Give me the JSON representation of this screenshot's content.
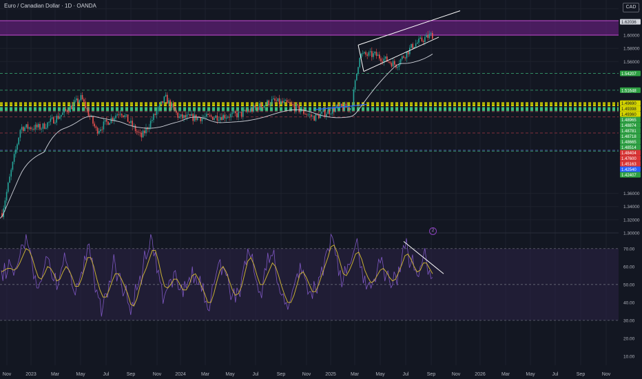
{
  "header": {
    "title": "Euro / Canadian Dollar · 1D · OANDA",
    "currency": "CAD",
    "rsi_badge": "2"
  },
  "colors": {
    "background": "#131722",
    "candle_up": "#26a69a",
    "candle_down": "#ef5350",
    "zone_fill": "#5c1f73",
    "zone_border": "#c64bd3",
    "moving_average": "#d1d4dc",
    "support_dashed": "#3fbf7f",
    "yellow_band": "#d4d400",
    "green_band": "#3fbf3f",
    "wedge": "#ffffff",
    "trendline": "#2962ff",
    "rsi_line": "#7e57c2",
    "rsi_ma": "#c9b036",
    "rsi_band": "#2a2143"
  },
  "chart_data": [
    {
      "type": "candlestick",
      "title": "Euro / Canadian Dollar · 1D · OANDA",
      "x_ticks": [
        "Nov",
        "2023",
        "Mar",
        "May",
        "Jul",
        "Sep",
        "Nov",
        "2024",
        "Mar",
        "May",
        "Jul",
        "Sep",
        "Nov",
        "2025",
        "Mar",
        "May",
        "Jul",
        "Sep",
        "Nov",
        "2026",
        "Mar",
        "May",
        "Jul",
        "Sep",
        "Nov"
      ],
      "y_ticks": [
        "1.64000",
        "1.60000",
        "1.58000",
        "1.56000",
        "1.36000",
        "1.34000",
        "1.32000",
        "1.30000"
      ],
      "ylim": [
        1.3,
        1.645
      ],
      "price_labels": [
        {
          "text": "1.62036",
          "value": 1.62036,
          "bg": "#d1d4dc",
          "fg": "#131722"
        },
        {
          "text": "1.54207",
          "value": 1.54207,
          "bg": "#2ea043",
          "fg": "#ffffff"
        },
        {
          "text": "1.51648",
          "value": 1.51648,
          "bg": "#2ea043",
          "fg": "#ffffff"
        },
        {
          "text": "1.49690",
          "value": 1.4969,
          "bg": "#d4d400",
          "fg": "#131722"
        },
        {
          "text": "1.49398",
          "value": 1.49398,
          "bg": "#d4d400",
          "fg": "#131722"
        },
        {
          "text": "1.49360",
          "value": 1.4936,
          "bg": "#d4d400",
          "fg": "#131722"
        },
        {
          "text": "1.48965",
          "value": 1.48965,
          "bg": "#2ea043",
          "fg": "#ffffff"
        },
        {
          "text": "1.48874",
          "value": 1.48874,
          "bg": "#2ea043",
          "fg": "#ffffff"
        },
        {
          "text": "1.48781",
          "value": 1.48781,
          "bg": "#2ea043",
          "fg": "#ffffff"
        },
        {
          "text": "1.48718",
          "value": 1.48718,
          "bg": "#2ea043",
          "fg": "#ffffff"
        },
        {
          "text": "1.48665",
          "value": 1.48665,
          "bg": "#2ea043",
          "fg": "#ffffff"
        },
        {
          "text": "1.48514",
          "value": 1.48514,
          "bg": "#2ea043",
          "fg": "#ffffff"
        },
        {
          "text": "1.48404",
          "value": 1.48404,
          "bg": "#d93636",
          "fg": "#ffffff"
        },
        {
          "text": "1.47600",
          "value": 1.476,
          "bg": "#d93636",
          "fg": "#ffffff"
        },
        {
          "text": "1.45163",
          "value": 1.45163,
          "bg": "#d93636",
          "fg": "#ffffff"
        },
        {
          "text": "1.42540",
          "value": 1.4254,
          "bg": "#2962ff",
          "fg": "#ffffff"
        },
        {
          "text": "1.42407",
          "value": 1.42407,
          "bg": "#2ea043",
          "fg": "#ffffff"
        }
      ],
      "zone": {
        "from": 1.6,
        "to": 1.622
      },
      "wedge_upper": [
        [
          "Mar",
          1.585
        ],
        [
          "Oct",
          1.634
        ]
      ],
      "wedge_lower": [
        [
          "Mar",
          1.545
        ],
        [
          "Aug",
          1.59
        ]
      ],
      "trendline": [
        [
          "Nov",
          1.487
        ],
        [
          "Mar",
          1.495
        ]
      ],
      "grid": true
    },
    {
      "type": "line",
      "title": "RSI",
      "y_ticks": [
        "70.00",
        "60.00",
        "50.00",
        "40.00",
        "30.00",
        "20.00",
        "10.00"
      ],
      "ylim": [
        5,
        78
      ],
      "levels": [
        70,
        50,
        30
      ],
      "series": [
        {
          "values": [
            58,
            62,
            57,
            61,
            55,
            60,
            66,
            72,
            78,
            70,
            62,
            55,
            48,
            52,
            60,
            65,
            58,
            52,
            47,
            55,
            61,
            63,
            57,
            49,
            44,
            50,
            57,
            66,
            72,
            64,
            55,
            47,
            42,
            38,
            45,
            52,
            58,
            61,
            56,
            50,
            46,
            40,
            33,
            38,
            47,
            55,
            60,
            64,
            70,
            75,
            68,
            58,
            50,
            44,
            48,
            53,
            57,
            52,
            47,
            43,
            48,
            54,
            60,
            55,
            50,
            46,
            40,
            36,
            42,
            50,
            58,
            64,
            60,
            55,
            48,
            44,
            40,
            46,
            54,
            63,
            70,
            65,
            57,
            51,
            46,
            52,
            58,
            62,
            66,
            58,
            50,
            44,
            39,
            36,
            42,
            49,
            56,
            62,
            58,
            52,
            46,
            42,
            47,
            54,
            60,
            65,
            70,
            78,
            73,
            66,
            58,
            52,
            56,
            61,
            66,
            72,
            68,
            60,
            55,
            50,
            48,
            53,
            58,
            62,
            60,
            56,
            52,
            50,
            55,
            60,
            65,
            70,
            68,
            62,
            58,
            55,
            60,
            66,
            63,
            58,
            54
          ]
        },
        {
          "values": [
            57,
            58,
            59,
            59,
            58,
            59,
            62,
            66,
            70,
            69,
            65,
            59,
            54,
            53,
            56,
            60,
            59,
            56,
            52,
            53,
            57,
            60,
            58,
            54,
            49,
            49,
            53,
            59,
            65,
            65,
            60,
            53,
            47,
            43,
            43,
            47,
            52,
            56,
            56,
            53,
            49,
            45,
            39,
            38,
            42,
            49,
            55,
            59,
            64,
            69,
            69,
            63,
            55,
            49,
            48,
            50,
            53,
            53,
            50,
            47,
            47,
            50,
            55,
            56,
            53,
            49,
            45,
            40,
            40,
            45,
            52,
            58,
            60,
            57,
            52,
            47,
            44,
            45,
            49,
            56,
            63,
            65,
            61,
            55,
            50,
            50,
            54,
            58,
            62,
            60,
            55,
            49,
            44,
            40,
            40,
            44,
            50,
            56,
            57,
            54,
            50,
            46,
            46,
            50,
            55,
            60,
            65,
            71,
            72,
            68,
            62,
            56,
            55,
            58,
            62,
            67,
            68,
            64,
            58,
            54,
            51,
            52,
            55,
            58,
            59,
            57,
            54,
            52,
            53,
            57,
            61,
            66,
            67,
            64,
            60,
            57,
            58,
            62,
            62,
            59,
            56
          ]
        }
      ],
      "trendline": [
        [
          "Jul",
          74
        ],
        [
          "Oct",
          56
        ]
      ],
      "grid": true
    }
  ]
}
